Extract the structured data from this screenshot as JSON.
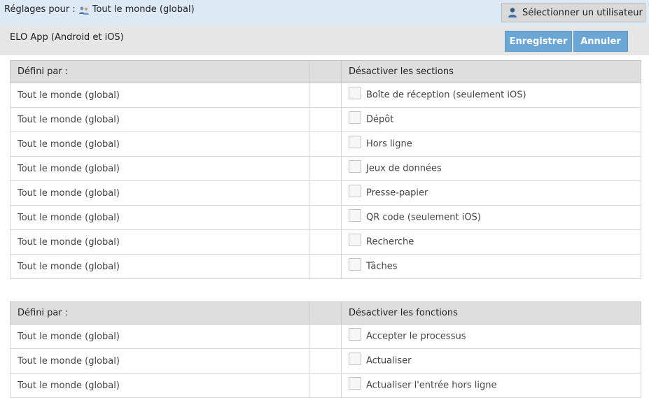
{
  "header": {
    "settings_for_label": "Réglages pour :",
    "scope": "Tout le monde (global)",
    "select_user_button": "Sélectionner un utilisateur"
  },
  "app": {
    "title": "ELO App (Android et iOS)",
    "save_button": "Enregistrer",
    "cancel_button": "Annuler"
  },
  "sections_table": {
    "columns": [
      "Défini par :",
      "",
      "Désactiver les sections"
    ],
    "rows": [
      {
        "defined_by": "Tout le monde (global)",
        "label": "Boîte de réception (seulement iOS)",
        "checked": false
      },
      {
        "defined_by": "Tout le monde (global)",
        "label": "Dépôt",
        "checked": false
      },
      {
        "defined_by": "Tout le monde (global)",
        "label": "Hors ligne",
        "checked": false
      },
      {
        "defined_by": "Tout le monde (global)",
        "label": "Jeux de données",
        "checked": false
      },
      {
        "defined_by": "Tout le monde (global)",
        "label": "Presse-papier",
        "checked": false
      },
      {
        "defined_by": "Tout le monde (global)",
        "label": "QR code (seulement iOS)",
        "checked": false
      },
      {
        "defined_by": "Tout le monde (global)",
        "label": "Recherche",
        "checked": false
      },
      {
        "defined_by": "Tout le monde (global)",
        "label": "Tâches",
        "checked": false
      }
    ]
  },
  "functions_table": {
    "columns": [
      "Défini par :",
      "",
      "Désactiver les fonctions"
    ],
    "rows": [
      {
        "defined_by": "Tout le monde (global)",
        "label": "Accepter le processus",
        "checked": false
      },
      {
        "defined_by": "Tout le monde (global)",
        "label": "Actualiser",
        "checked": false
      },
      {
        "defined_by": "Tout le monde (global)",
        "label": "Actualiser l'entrée hors ligne",
        "checked": false
      }
    ]
  },
  "colors": {
    "header_bg": "#dde9f5",
    "appbar_bg": "#e6e6e6",
    "button_blue": "#6aa6d6",
    "table_header_bg": "#dedede"
  }
}
